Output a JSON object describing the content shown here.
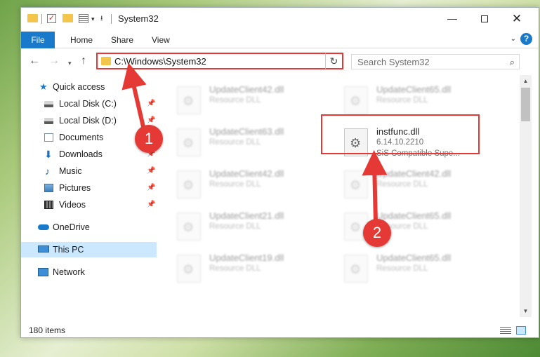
{
  "window": {
    "title": "System32",
    "minimize_glyph": "—",
    "close_glyph": "✕"
  },
  "ribbon": {
    "tabs": [
      "File",
      "Home",
      "Share",
      "View"
    ],
    "expand_glyph": "⌄",
    "help_glyph": "?"
  },
  "address": {
    "path": "C:\\Windows\\System32",
    "refresh_glyph": "↻"
  },
  "search": {
    "placeholder": "Search System32"
  },
  "sidebar": {
    "items": [
      {
        "label": "Quick access",
        "icon": "star-icon"
      },
      {
        "label": "Local Disk (C:)",
        "icon": "disk-icon",
        "pinned": true
      },
      {
        "label": "Local Disk (D:)",
        "icon": "disk-icon",
        "pinned": true
      },
      {
        "label": "Documents",
        "icon": "documents-icon",
        "pinned": true
      },
      {
        "label": "Downloads",
        "icon": "download-icon",
        "pinned": true
      },
      {
        "label": "Music",
        "icon": "music-icon",
        "pinned": true
      },
      {
        "label": "Pictures",
        "icon": "pictures-icon",
        "pinned": true
      },
      {
        "label": "Videos",
        "icon": "videos-icon",
        "pinned": true
      },
      {
        "label": "OneDrive",
        "icon": "cloud-icon"
      },
      {
        "label": "This PC",
        "icon": "computer-icon",
        "selected": true
      },
      {
        "label": "Network",
        "icon": "network-icon"
      }
    ]
  },
  "files": [
    {
      "name": "UpdateClient42.dll",
      "desc": "Resource DLL"
    },
    {
      "name": "UpdateClient65.dll",
      "desc": "Resource DLL"
    },
    {
      "name": "UpdateClient63.dll",
      "desc": "Resource DLL"
    },
    {
      "name": "instfunc.dll",
      "version": "6.14.10.2210",
      "desc": "SiS Compatible Supe..."
    },
    {
      "name": "UpdateClient42.dll",
      "desc": "Resource DLL"
    },
    {
      "name": "UpdateClient42.dll",
      "desc": "Resource DLL"
    },
    {
      "name": "UpdateClient21.dll",
      "desc": "Resource DLL"
    },
    {
      "name": "UpdateClient65.dll",
      "desc": "Resource DLL"
    },
    {
      "name": "UpdateClient19.dll",
      "desc": "Resource DLL"
    },
    {
      "name": "UpdateClient65.dll",
      "desc": "Resource DLL"
    }
  ],
  "status": {
    "item_count": "180 items"
  },
  "annotations": {
    "step1": "1",
    "step2": "2"
  },
  "colors": {
    "accent": "#1979ca",
    "annotation_red": "#e53935",
    "selected_bg": "#cce8ff"
  }
}
